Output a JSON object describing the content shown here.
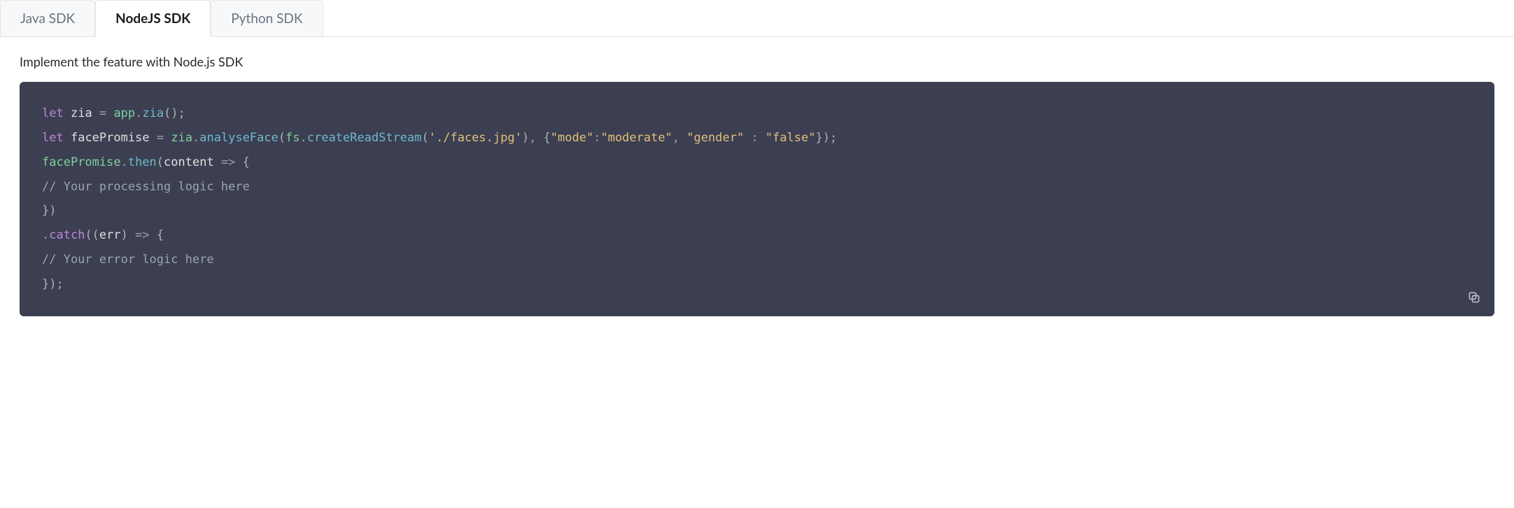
{
  "tabs": {
    "items": [
      {
        "label": "Java SDK",
        "active": false
      },
      {
        "label": "NodeJS SDK",
        "active": true
      },
      {
        "label": "Python SDK",
        "active": false
      }
    ]
  },
  "content": {
    "description": "Implement the feature with Node.js SDK"
  },
  "code": {
    "line1": {
      "let": "let",
      "zia": "zia",
      "eq": "=",
      "app": "app",
      "dot": ".",
      "ziaFn": "zia",
      "parens": "();"
    },
    "line2": {
      "let": "let",
      "facePromise": "facePromise",
      "eq": "=",
      "zia": "zia",
      "dot": ".",
      "analyseFace": "analyseFace",
      "open": "(",
      "fs": "fs",
      "dot2": ".",
      "createReadStream": "createReadStream",
      "open2": "(",
      "path": "'./faces.jpg'",
      "close2": ")",
      "comma": ", ",
      "objOpen": "{",
      "modeKey": "\"mode\"",
      "colon1": ":",
      "modeVal": "\"moderate\"",
      "comma2": ", ",
      "genderKey": "\"gender\"",
      "colon2": " : ",
      "genderVal": "\"false\"",
      "objClose": "}",
      "close": ");"
    },
    "line3": {
      "facePromise": "facePromise",
      "dot": ".",
      "then": "then",
      "open": "(",
      "content": "content",
      "arrow": " => ",
      "brace": "{"
    },
    "line4": {
      "comment": "// Your processing logic here"
    },
    "line5": {
      "close": "})"
    },
    "line6": {
      "dot": ".",
      "catch": "catch",
      "open": "((",
      "err": "err",
      "close": ")",
      "arrow": " => ",
      "brace": "{"
    },
    "line7": {
      "comment": "// Your error logic here"
    },
    "line8": {
      "close": "});"
    }
  }
}
